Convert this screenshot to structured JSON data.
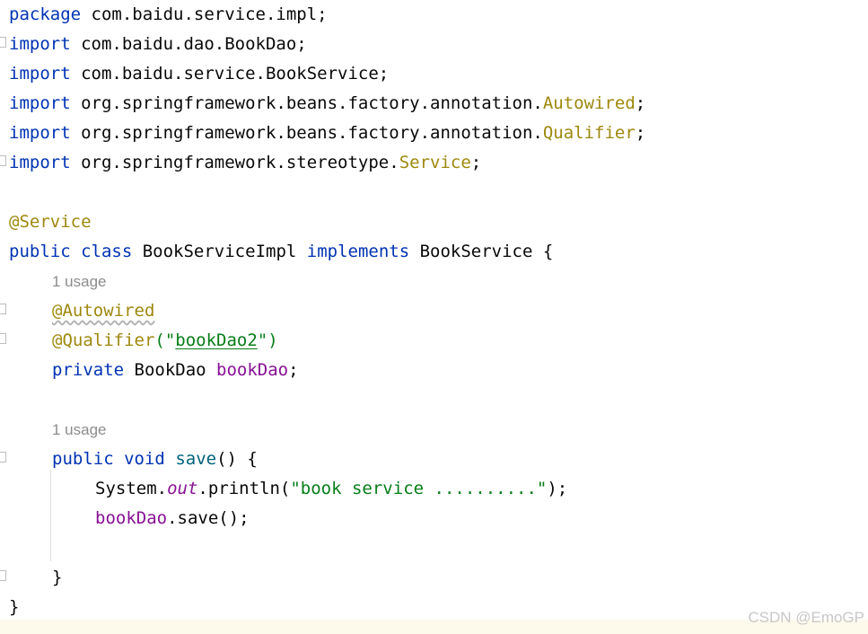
{
  "code": {
    "l1": [
      "package",
      " com.baidu.service.impl;"
    ],
    "l2": [
      "import",
      " com.baidu.dao.BookDao;"
    ],
    "l3": [
      "import",
      " com.baidu.service.BookService;"
    ],
    "l4": [
      "import",
      " org.springframework.beans.factory.annotation.",
      "Autowired",
      ";"
    ],
    "l5": [
      "import",
      " org.springframework.beans.factory.annotation.",
      "Qualifier",
      ";"
    ],
    "l6": [
      "import",
      " org.springframework.stereotype.",
      "Service",
      ";"
    ],
    "l7": [
      "@Service"
    ],
    "l8": [
      "public",
      " ",
      "class",
      " BookServiceImpl ",
      "implements",
      " BookService {"
    ],
    "hint1": "1 usage",
    "l9": [
      "@Autowired"
    ],
    "l10": [
      "@Qualifier",
      "(\"",
      "bookDao2",
      "\")"
    ],
    "l11": [
      "private",
      " BookDao ",
      "bookDao",
      ";"
    ],
    "hint2": "1 usage",
    "l12": [
      "public",
      " ",
      "void",
      " ",
      "save",
      "() {"
    ],
    "l13": [
      "System.",
      "out",
      ".println(",
      "\"book service ..........\"",
      ");"
    ],
    "l14": [
      "bookDao",
      ".save();"
    ],
    "l15": [
      "}"
    ],
    "l16": [
      "}"
    ]
  },
  "watermark": "CSDN @EmoGP",
  "colors": {
    "keyword": "#0033b3",
    "annotation": "#9e880d",
    "string": "#067d17",
    "field": "#871094",
    "method": "#00627a",
    "inlay_hint": "#8c8c8c"
  }
}
